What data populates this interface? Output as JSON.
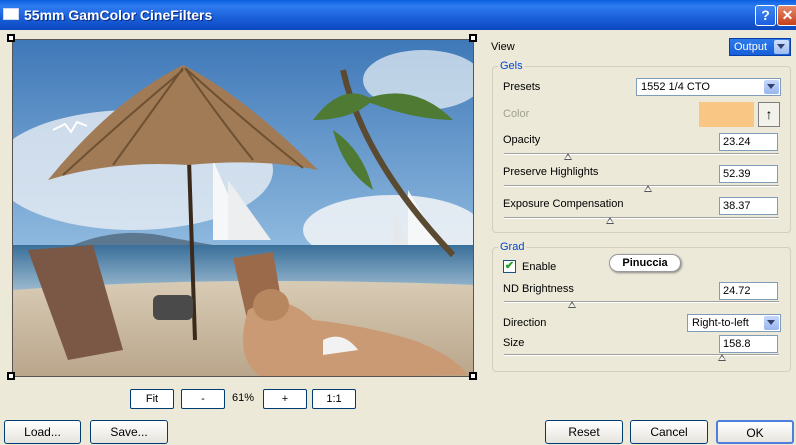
{
  "window": {
    "title": "55mm GamColor CineFilters",
    "help_label": "?",
    "close_label": "✕"
  },
  "preview": {
    "zoom_label": "61%",
    "fit_label": "Fit",
    "minus_label": "-",
    "plus_label": "+",
    "one_to_one_label": "1:1"
  },
  "view": {
    "label": "View",
    "value": "Output"
  },
  "gels": {
    "title": "Gels",
    "presets_label": "Presets",
    "presets_value": "1552 1/4 CTO",
    "color_label": "Color",
    "color_value": "#f9c783",
    "opacity": {
      "label": "Opacity",
      "value": "23.24",
      "level": 0.2324
    },
    "preserve": {
      "label": "Preserve Highlights",
      "value": "52.39",
      "level": 0.5239
    },
    "exposure": {
      "label": "Exposure Compensation",
      "value": "38.37",
      "level": 0.3837
    }
  },
  "grad": {
    "title": "Grad",
    "enable_label": "Enable",
    "enable_checked": true,
    "watermark": "Pinuccia",
    "nd_brightness": {
      "label": "ND Brightness",
      "value": "24.72",
      "level": 0.2472
    },
    "direction_label": "Direction",
    "direction_value": "Right-to-left",
    "size": {
      "label": "Size",
      "value": "158.8",
      "level": 0.794
    }
  },
  "buttons": {
    "load": "Load...",
    "save": "Save...",
    "reset": "Reset",
    "cancel": "Cancel",
    "ok": "OK"
  },
  "colors": {
    "titlebar": "#0c55d8",
    "accent_text": "#0046d5",
    "swatch": "#f9c783"
  }
}
